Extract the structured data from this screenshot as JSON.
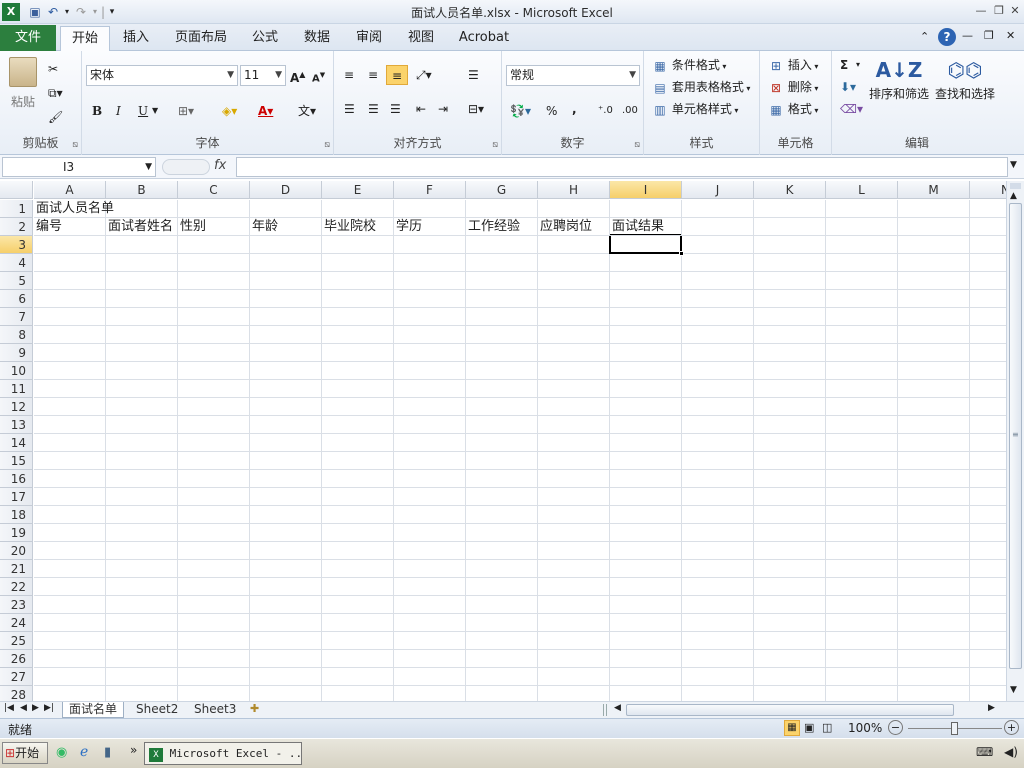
{
  "window": {
    "title": "面试人员名单.xlsx - Microsoft Excel",
    "app_icon": "excel-icon"
  },
  "ribbon_tabs": [
    "文件",
    "开始",
    "插入",
    "页面布局",
    "公式",
    "数据",
    "审阅",
    "视图",
    "Acrobat"
  ],
  "active_tab": "开始",
  "groups": {
    "clipboard": {
      "label": "剪贴板",
      "paste": "粘贴"
    },
    "font": {
      "label": "字体",
      "font_name": "宋体",
      "font_size": "11",
      "bold": "B",
      "italic": "I",
      "underline": "U"
    },
    "alignment": {
      "label": "对齐方式"
    },
    "number": {
      "label": "数字",
      "format": "常规",
      "percent": "%",
      "comma": ","
    },
    "styles": {
      "label": "样式",
      "conditional": "条件格式",
      "table": "套用表格格式",
      "cell_styles": "单元格样式"
    },
    "cells": {
      "label": "单元格",
      "insert": "插入",
      "delete": "删除",
      "format": "格式"
    },
    "editing": {
      "label": "编辑",
      "sum": "Σ",
      "sort_filter": "排序和筛选",
      "find_select": "查找和选择"
    }
  },
  "formula_bar": {
    "name_box": "I3",
    "fx": "fx",
    "content": ""
  },
  "columns": [
    "A",
    "B",
    "C",
    "D",
    "E",
    "F",
    "G",
    "H",
    "I",
    "J",
    "K",
    "L",
    "M",
    "N"
  ],
  "selected_column": "I",
  "rows": [
    "1",
    "2",
    "3",
    "4",
    "5",
    "6",
    "7",
    "8",
    "9",
    "10",
    "11",
    "12",
    "13",
    "14",
    "15",
    "16",
    "17",
    "18",
    "19",
    "20",
    "21",
    "22",
    "23",
    "24",
    "25",
    "26",
    "27",
    "28"
  ],
  "selected_row": "3",
  "cells": {
    "A1": "面试人员名单",
    "A2": "编号",
    "B2": "面试者姓名",
    "C2": "性别",
    "D2": "年龄",
    "E2": "毕业院校",
    "F2": "学历",
    "G2": "工作经验",
    "H2": "应聘岗位",
    "I2": "面试结果"
  },
  "sheets": [
    "面试名单",
    "Sheet2",
    "Sheet3"
  ],
  "active_sheet": "面试名单",
  "status": {
    "ready": "就绪",
    "zoom": "100%"
  },
  "taskbar": {
    "start": "开始",
    "task": "Microsoft Excel - ..."
  }
}
